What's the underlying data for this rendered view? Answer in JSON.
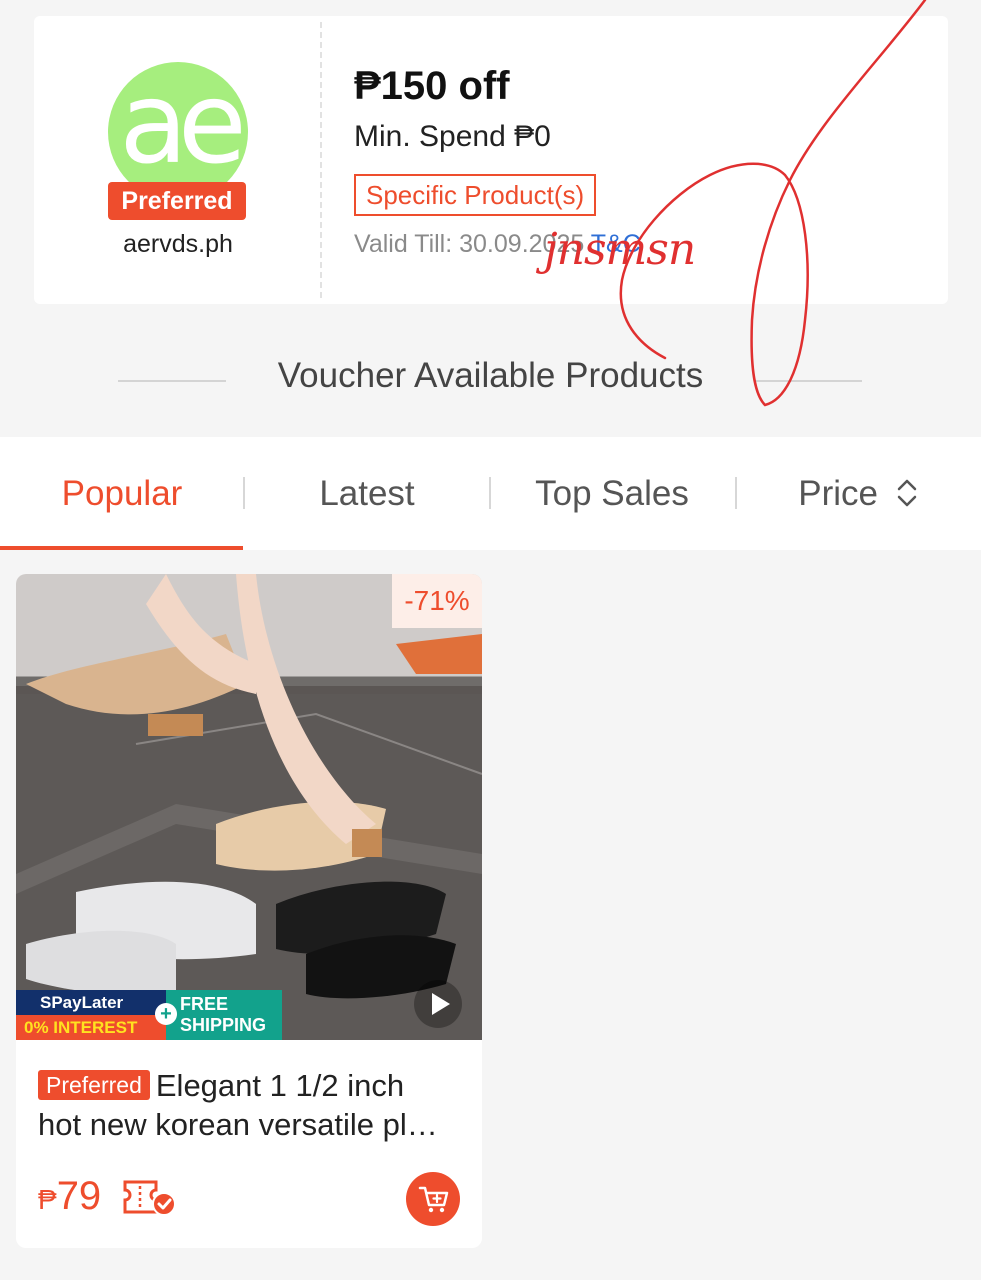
{
  "voucher": {
    "shop_logo_text": "ae",
    "preferred_badge": "Preferred",
    "shop_name": "aervds.ph",
    "discount_title": "₱150 off",
    "min_spend": "Min. Spend ₱0",
    "scope_tag": "Specific Product(s)",
    "valid_till": "Valid Till: 30.09.2025",
    "tnc_link": "T&C",
    "handwritten_mark": "jnsmsn"
  },
  "section": {
    "title": "Voucher Available Products"
  },
  "tabs": [
    {
      "label": "Popular",
      "active": true
    },
    {
      "label": "Latest",
      "active": false
    },
    {
      "label": "Top Sales",
      "active": false
    },
    {
      "label": "Price",
      "active": false
    }
  ],
  "product": {
    "discount_badge": "-71%",
    "spaylater_label": "SPayLater",
    "interest_label": "0% INTEREST",
    "free_shipping_line1": "FREE",
    "free_shipping_line2": "SHIPPING",
    "preferred_badge": "Preferred",
    "title_line1": "Elegant 1 1/2 inch",
    "title_line2": "hot new korean versatile pl…",
    "currency": "₱",
    "price": "79",
    "icons": [
      "voucher-check-icon",
      "add-to-cart-icon",
      "play-icon",
      "sort-icon"
    ]
  },
  "colors": {
    "accent": "#ee4d2d",
    "logo_green": "#a6ee7e",
    "link_blue": "#2f6fd6",
    "shipping_teal": "#12a28c",
    "spaylater_navy": "#12306b"
  }
}
